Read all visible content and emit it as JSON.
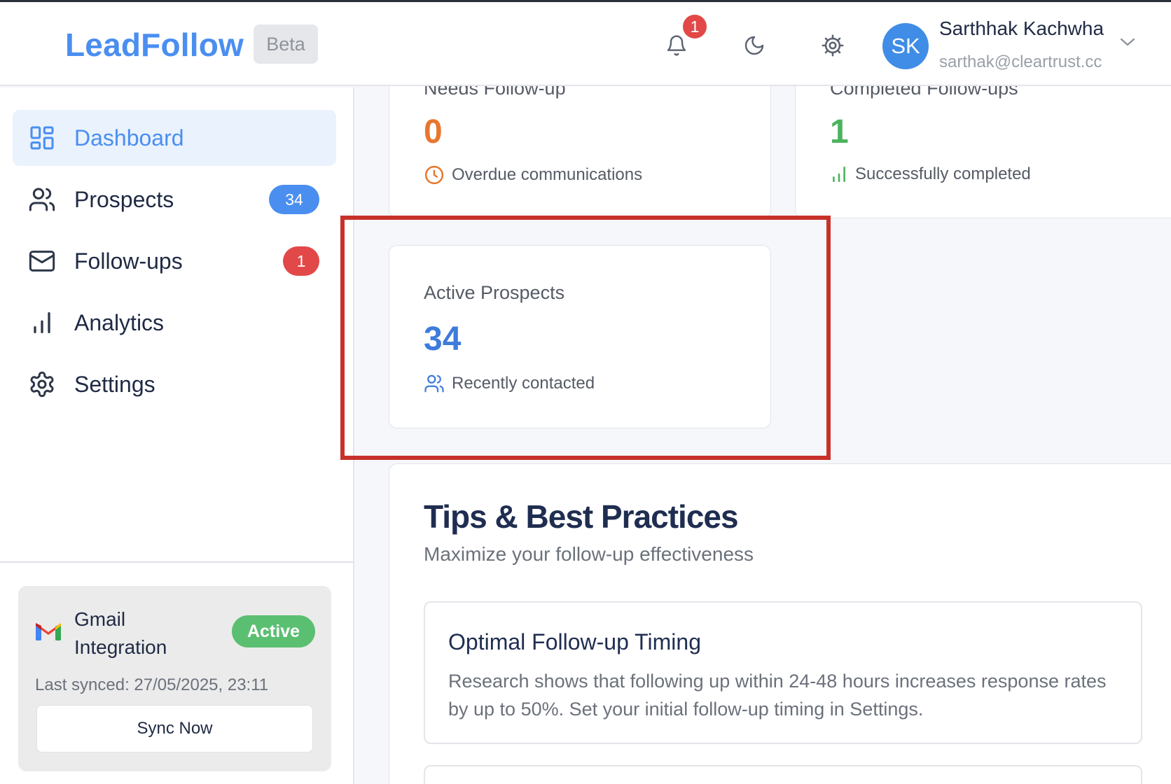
{
  "header": {
    "logo": "LeadFollow",
    "beta_label": "Beta",
    "notification_count": "1",
    "user": {
      "initials": "SK",
      "name": "Sarthhak Kachwha",
      "email": "sarthak@cleartrust.cc"
    }
  },
  "sidebar": {
    "items": [
      {
        "label": "Dashboard",
        "icon": "grid-icon",
        "active": true
      },
      {
        "label": "Prospects",
        "icon": "users-icon",
        "badge": "34"
      },
      {
        "label": "Follow-ups",
        "icon": "mail-icon",
        "badge": "1"
      },
      {
        "label": "Analytics",
        "icon": "bar-chart-icon"
      },
      {
        "label": "Settings",
        "icon": "gear-icon"
      }
    ],
    "gmail": {
      "title": "Gmail Integration",
      "status": "Active",
      "last_synced": "Last synced: 27/05/2025, 23:11",
      "sync_button": "Sync Now"
    }
  },
  "stats": {
    "needs_followup": {
      "label": "Needs Follow-up",
      "value": "0",
      "sub": "Overdue communications",
      "color": "#e8772e"
    },
    "completed": {
      "label": "Completed Follow-ups",
      "value": "1",
      "sub": "Successfully completed",
      "color": "#4cb35e"
    },
    "active": {
      "label": "Active Prospects",
      "value": "34",
      "sub": "Recently contacted",
      "color": "#3d7bdc"
    }
  },
  "tips": {
    "title": "Tips & Best Practices",
    "subtitle": "Maximize your follow-up effectiveness",
    "items": [
      {
        "title": "Optimal Follow-up Timing",
        "body": "Research shows that following up within 24-48 hours increases response rates by up to 50%. Set your initial follow-up timing in Settings."
      }
    ]
  },
  "colors": {
    "accent": "#4a8ef0",
    "danger": "#e24848",
    "success": "#5bbf72",
    "highlight": "#c8312a"
  }
}
